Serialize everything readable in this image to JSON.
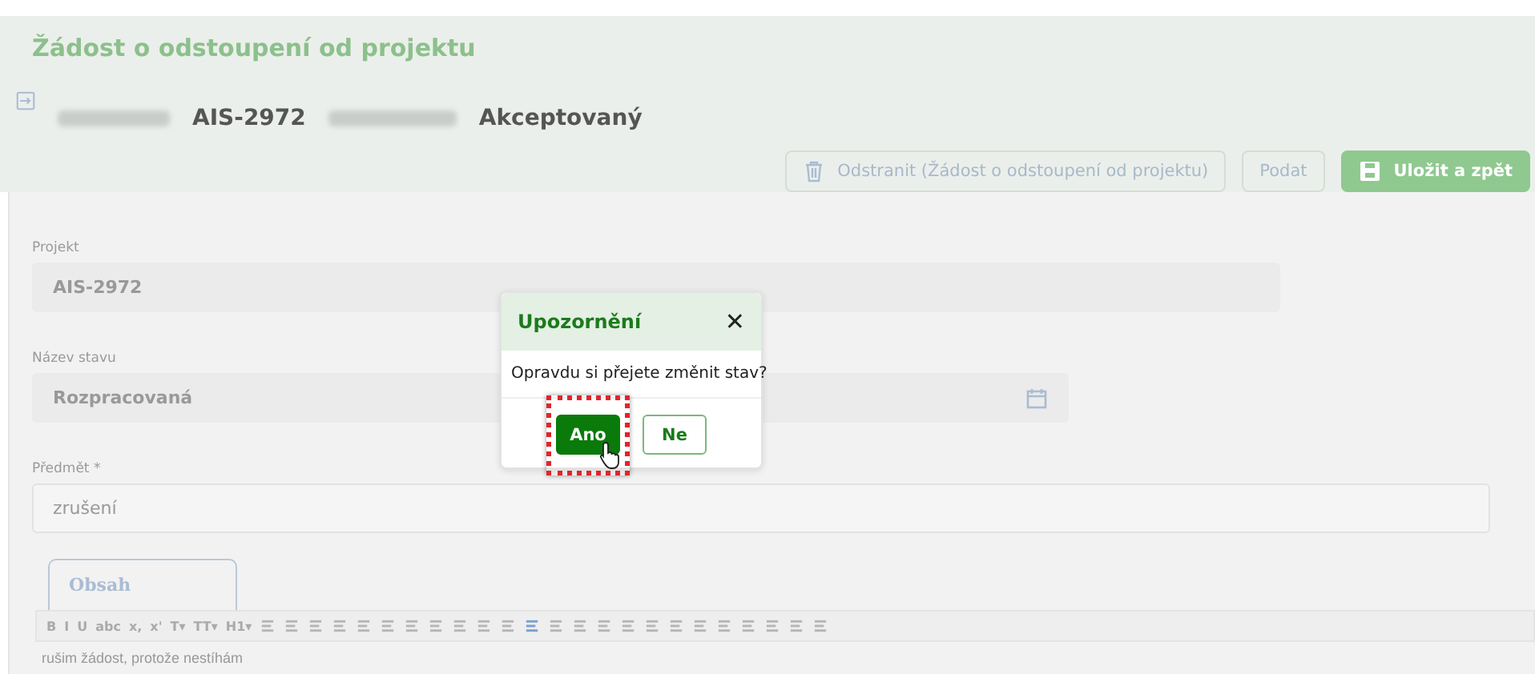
{
  "header": {
    "title": "Žádost o odstoupení od projektu",
    "project_code": "AIS-2972",
    "status": "Akceptovaný"
  },
  "actions": [
    {
      "label": "Odstranit (Žádost o odstoupení od projektu)",
      "kind": "delete"
    },
    {
      "label": "Podat",
      "kind": "plain"
    },
    {
      "label": "Uložit a zpět",
      "kind": "save"
    }
  ],
  "fields": [
    {
      "label": "Projekt",
      "value": "AIS-2972",
      "kind": "readonly"
    },
    {
      "label": "Název stavu",
      "value": "Rozpracovaná",
      "kind": "date"
    },
    {
      "label": "Předmět *",
      "value": "zrušení",
      "kind": "input"
    }
  ],
  "tabs": [
    {
      "label": "Obsah",
      "selected": true
    }
  ],
  "editor": {
    "toolbar": [
      "B",
      "I",
      "U",
      "abc",
      "x,",
      "x'",
      "T▾",
      "TT▾",
      "H1▾"
    ],
    "content": "rušim žádost, protože nestíhám"
  },
  "dialog": {
    "title": "Upozornění",
    "close": "✕",
    "message": "Opravdu si přejete změnit stav?",
    "buttons": [
      {
        "label": "Ano",
        "kind": "primary",
        "highlighted": true
      },
      {
        "label": "Ne",
        "kind": "secondary",
        "highlighted": false
      }
    ]
  }
}
